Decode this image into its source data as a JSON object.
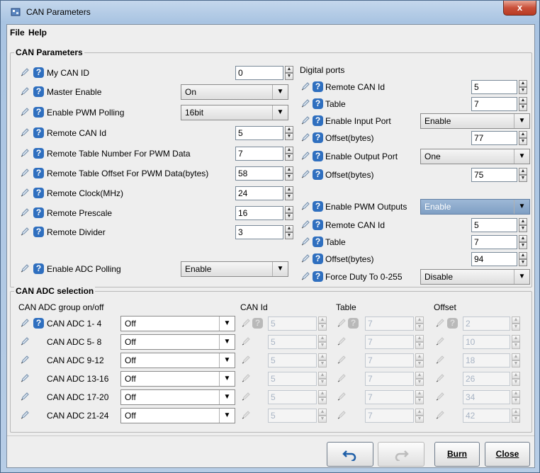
{
  "window": {
    "title": "CAN Parameters",
    "close_label": "x"
  },
  "menu": {
    "file": "File",
    "help": "Help"
  },
  "can_params": {
    "legend": "CAN Parameters",
    "my_can_id": {
      "label": "My CAN ID",
      "value": "0"
    },
    "master_enable": {
      "label": "Master Enable",
      "value": "On"
    },
    "enable_pwm_polling": {
      "label": "Enable PWM Polling",
      "value": "16bit"
    },
    "remote_can_id": {
      "label": "Remote CAN Id",
      "value": "5"
    },
    "remote_table_pwm": {
      "label": "Remote Table Number For PWM Data",
      "value": "7"
    },
    "remote_offset_pwm": {
      "label": "Remote Table Offset For PWM Data(bytes)",
      "value": "58"
    },
    "remote_clock": {
      "label": "Remote Clock(MHz)",
      "value": "24"
    },
    "remote_prescale": {
      "label": "Remote Prescale",
      "value": "16"
    },
    "remote_divider": {
      "label": "Remote Divider",
      "value": "3"
    },
    "enable_adc_polling": {
      "label": "Enable ADC Polling",
      "value": "Enable"
    }
  },
  "digital": {
    "title": "Digital ports",
    "remote_can_id": {
      "label": "Remote CAN Id",
      "value": "5"
    },
    "table": {
      "label": "Table",
      "value": "7"
    },
    "enable_input_port": {
      "label": "Enable Input Port",
      "value": "Enable"
    },
    "input_offset": {
      "label": "Offset(bytes)",
      "value": "77"
    },
    "enable_output_port": {
      "label": "Enable Output Port",
      "value": "One"
    },
    "output_offset": {
      "label": "Offset(bytes)",
      "value": "75"
    }
  },
  "pwm": {
    "enable_pwm_outputs": {
      "label": "Enable PWM Outputs",
      "value": "Enable"
    },
    "remote_can_id": {
      "label": "Remote CAN Id",
      "value": "5"
    },
    "table": {
      "label": "Table",
      "value": "7"
    },
    "offset": {
      "label": "Offset(bytes)",
      "value": "94"
    },
    "force_duty": {
      "label": "Force Duty To 0-255",
      "value": "Disable"
    }
  },
  "adc": {
    "legend": "CAN ADC selection",
    "col_group": "CAN ADC group on/off",
    "col_canid": "CAN Id",
    "col_table": "Table",
    "col_offset": "Offset",
    "rows": [
      {
        "label": "CAN ADC  1- 4",
        "state": "Off",
        "can_id": "5",
        "table": "7",
        "offset": "2"
      },
      {
        "label": "CAN ADC  5- 8",
        "state": "Off",
        "can_id": "5",
        "table": "7",
        "offset": "10"
      },
      {
        "label": "CAN ADC  9-12",
        "state": "Off",
        "can_id": "5",
        "table": "7",
        "offset": "18"
      },
      {
        "label": "CAN ADC 13-16",
        "state": "Off",
        "can_id": "5",
        "table": "7",
        "offset": "26"
      },
      {
        "label": "CAN ADC 17-20",
        "state": "Off",
        "can_id": "5",
        "table": "7",
        "offset": "34"
      },
      {
        "label": "CAN ADC 21-24",
        "state": "Off",
        "can_id": "5",
        "table": "7",
        "offset": "42"
      }
    ]
  },
  "buttons": {
    "burn": "Burn",
    "close": "Close"
  }
}
